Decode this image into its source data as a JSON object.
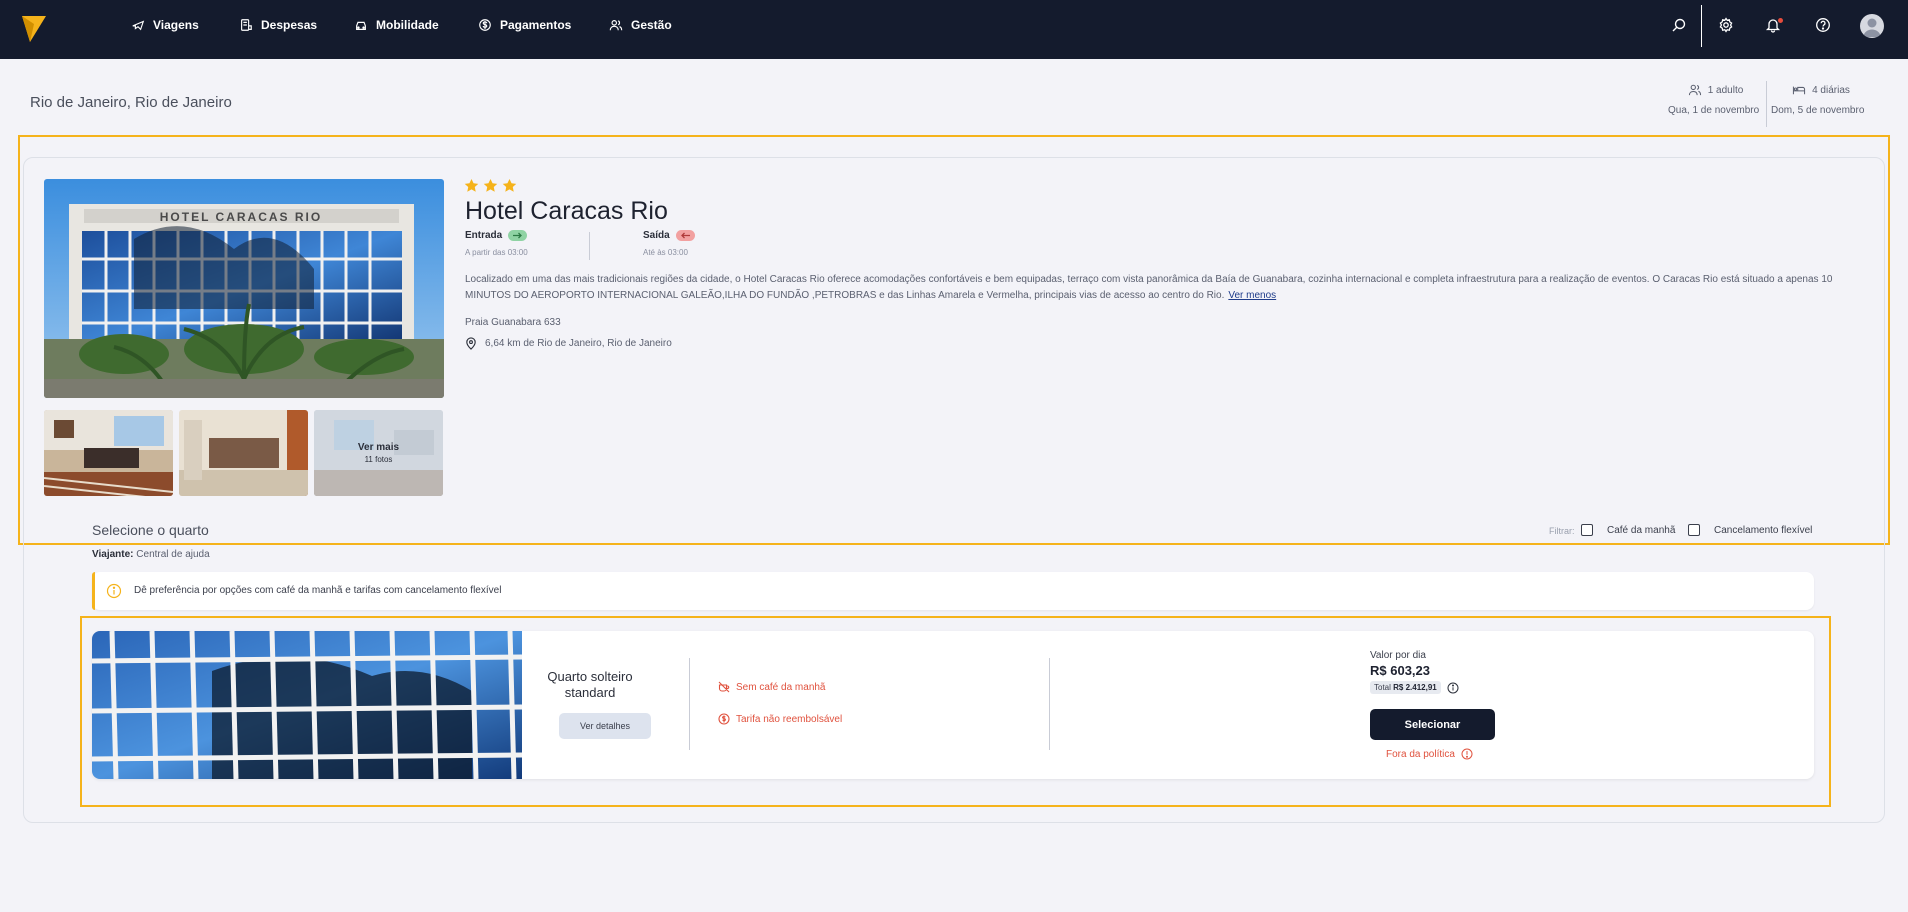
{
  "nav": {
    "items": [
      {
        "label": "Viagens",
        "icon": "plane-icon"
      },
      {
        "label": "Despesas",
        "icon": "receipt-icon"
      },
      {
        "label": "Mobilidade",
        "icon": "car-icon"
      },
      {
        "label": "Pagamentos",
        "icon": "dollar-icon"
      },
      {
        "label": "Gestão",
        "icon": "users-icon"
      }
    ],
    "right_icons": [
      "search-icon",
      "gear-icon",
      "bell-icon",
      "help-icon",
      "avatar"
    ]
  },
  "header": {
    "title": "Rio de Janeiro, Rio de Janeiro",
    "guests": "1 adulto",
    "checkin_date": "Qua, 1 de novembro",
    "nights": "4 diárias",
    "checkout_date": "Dom, 5 de novembro"
  },
  "hotel": {
    "stars": 3,
    "name": "Hotel Caracas Rio",
    "checkin_label": "Entrada",
    "checkin_time": "A partir das 03:00",
    "checkout_label": "Saída",
    "checkout_time": "Até às 03:00",
    "description": "Localizado em uma das mais tradicionais regiões da cidade, o Hotel Caracas Rio oferece acomodações confortáveis e bem equipadas, terraço com vista panorâmica da Baía de Guanabara, cozinha internacional e completa infraestrutura para a realização de eventos. O Caracas Rio está situado a apenas 10 MINUTOS DO AEROPORTO INTERNACIONAL GALEÃO,ILHA DO FUNDÃO ,PETROBRAS e das Linhas Amarela e Vermelha, principais vias de acesso ao centro do Rio.",
    "see_less": "Ver menos",
    "address": "Praia Guanabara 633",
    "distance": "6,64 km de Rio de Janeiro, Rio de Janeiro",
    "photo_sign": "HOTEL CARACAS RIO",
    "see_more": "Ver mais",
    "photo_count": "11 fotos"
  },
  "rooms": {
    "title": "Selecione o quarto",
    "filter_label": "Filtrar:",
    "filter_breakfast": "Café da manhã",
    "filter_flexible": "Cancelamento flexível",
    "traveler_label": "Viajante:",
    "traveler_value": "Central de ajuda",
    "alert": "Dê preferência por opções com café da manhã e tarifas com cancelamento flexível",
    "items": [
      {
        "name": "Quarto solteiro standard",
        "details_button": "Ver detalhes",
        "breakfast": "Sem café da manhã",
        "refund": "Tarifa não reembolsável",
        "price_label": "Valor por dia",
        "price": "R$ 603,23",
        "total_label": "Total",
        "total_value": "R$ 2.412,91",
        "select_button": "Selecionar",
        "policy": "Fora da política"
      }
    ]
  },
  "colors": {
    "nav_bg": "#141b2d",
    "accent_yellow": "#f5b31b",
    "danger": "#e0523e",
    "checkin_green": "#8fd3a4",
    "checkout_red": "#f2a0a0"
  }
}
